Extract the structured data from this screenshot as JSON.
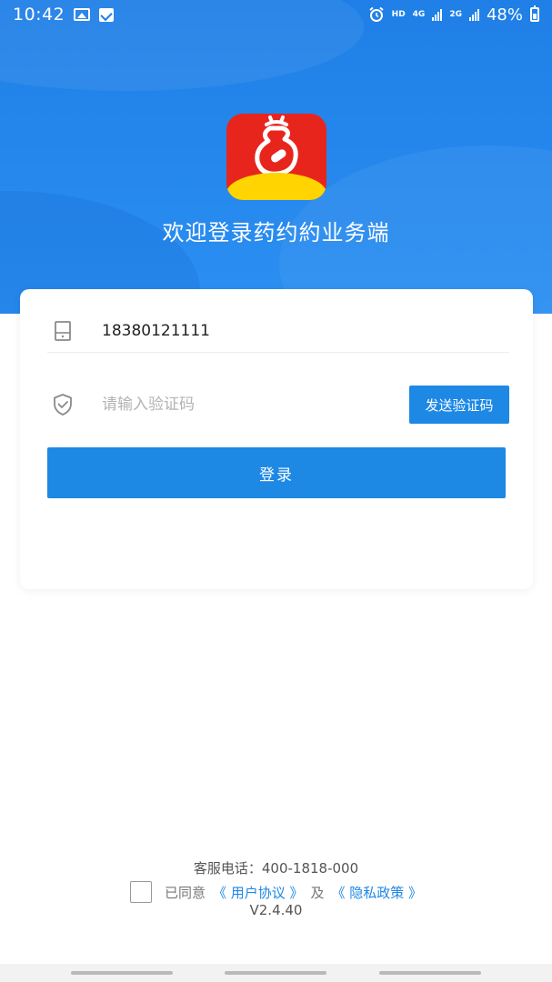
{
  "status_bar": {
    "time": "10:42",
    "hd_label": "HD",
    "network_1": "4G",
    "network_2": "2G",
    "battery_percent": "48%"
  },
  "header": {
    "logo_icon": "yaoyueyue-app-logo",
    "title": "欢迎登录药约約业务端",
    "colors": {
      "primary_blue": "#1f7fe6",
      "logo_red": "#e8251d",
      "logo_yellow": "#ffd400"
    }
  },
  "login_form": {
    "phone": {
      "icon": "phone-icon",
      "value": "18380121111"
    },
    "code": {
      "icon": "shield-icon",
      "placeholder": "请输入验证码",
      "send_label": "发送验证码"
    },
    "login_label": "登录"
  },
  "footer": {
    "hotline": "客服电话：400-1818-000",
    "agree_text": "已同意",
    "user_agreement": "《 用户协议 》",
    "and_text": "及",
    "privacy_policy": "《 隐私政策 》",
    "version": "V2.4.40"
  }
}
